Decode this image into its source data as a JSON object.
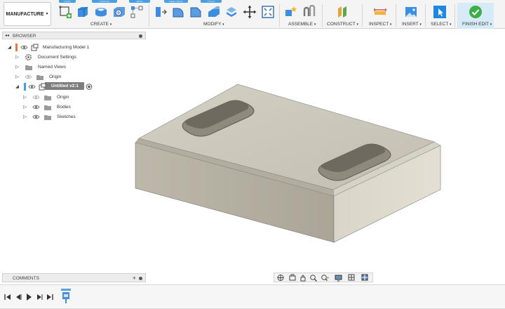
{
  "toolbar": {
    "workspace_label": "MANUFACTURE",
    "tabs": [
      "SOLID",
      "SURFACE",
      "MESH",
      "SHEET METAL",
      "TOOLS"
    ],
    "groups": {
      "create": "CREATE",
      "modify": "MODIFY",
      "assemble": "ASSEMBLE",
      "construct": "CONSTRUCT",
      "inspect": "INSPECT",
      "insert": "INSERT",
      "select": "SELECT",
      "finish_edit": "FINISH EDIT"
    },
    "accent_color": "#2e86de",
    "finish_color": "#3fae49"
  },
  "browser": {
    "title": "BROWSER",
    "items": [
      {
        "label": "Manufacturing Model 1",
        "icon": "component-icon"
      },
      {
        "label": "Document Settings",
        "icon": "gear-icon"
      },
      {
        "label": "Named Views",
        "icon": "folder-icon"
      },
      {
        "label": "Origin",
        "icon": "folder-icon"
      },
      {
        "label": "Untitled v2:1",
        "icon": "component-icon",
        "state": "active"
      },
      {
        "label": "Origin",
        "icon": "folder-icon"
      },
      {
        "label": "Bodies",
        "icon": "folder-icon"
      },
      {
        "label": "Sketches",
        "icon": "folder-icon"
      }
    ]
  },
  "comments": {
    "title": "COMMENTS"
  }
}
